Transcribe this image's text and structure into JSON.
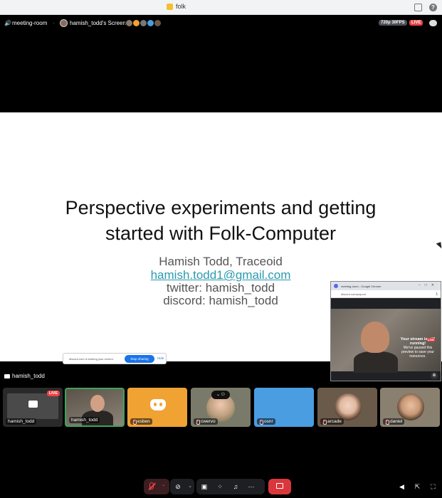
{
  "window": {
    "title": "folk"
  },
  "stream": {
    "channel": "meeting-room",
    "separator": "·",
    "owner": "hamish_todd's Screen",
    "quality": "720p 30FPS",
    "live_label": "LIVE",
    "viewer_colors": [
      "#8a7a6a",
      "#f0a232",
      "#777777",
      "#4a9de0",
      "#6a5a4a"
    ]
  },
  "slide": {
    "title_line1": "Perspective experiments and getting",
    "title_line2": "started with Folk-Computer",
    "author": "Hamish Todd, Traceoid",
    "email": "hamish.todd1@gmail.com",
    "twitter": "twitter: hamish_todd",
    "discord": "discord: hamish_todd"
  },
  "share_bar": {
    "message": "discord.com is sharing your screen.",
    "stop_label": "Stop sharing",
    "hide_label": "Hide"
  },
  "popout": {
    "window_title": "meeting-room - Google Chrome",
    "url": "discord.com/popout",
    "msg_line1": "Your stream is still",
    "msg_line2": "running!",
    "msg_line3": "We've paused this",
    "msg_line4": "preview to save your",
    "msg_line5": "resources.",
    "live_label": "LIVE"
  },
  "strip": {
    "label": "hamish_todd",
    "tiles": [
      {
        "name": "hamish_todd",
        "live": "LIVE"
      },
      {
        "name": "hamish_todd"
      },
      {
        "name": "esben"
      },
      {
        "name": "cwervo"
      },
      {
        "name": "osnr"
      },
      {
        "name": "arcade"
      },
      {
        "name": "daniel"
      }
    ]
  },
  "icons": {
    "speaker": "🔊",
    "more": "⋯",
    "caret": "⌄",
    "zoom": "⊕",
    "inbox": "▭",
    "help": "?"
  },
  "colors": {
    "live": "#ed4245",
    "speaking": "#3ba55d",
    "end_call": "#da373c",
    "link": "#2a9aaf"
  }
}
